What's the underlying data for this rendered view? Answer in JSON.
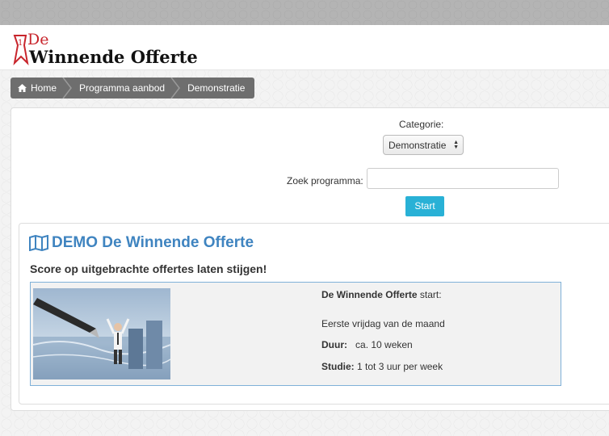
{
  "logo": {
    "small": "De",
    "main": "Winnende Offerte"
  },
  "breadcrumb": {
    "home": "Home",
    "programs": "Programma aanbod",
    "current": "Demonstratie"
  },
  "filter": {
    "category_label": "Categorie:",
    "category_value": "Demonstratie",
    "search_label": "Zoek programma:",
    "search_value": "",
    "start_label": "Start"
  },
  "program": {
    "title": "DEMO De Winnende Offerte",
    "subtitle": "Score op uitgebrachte offertes laten stijgen!",
    "name": "De Winnende Offerte",
    "start_suffix": "start:",
    "start_date": "Eerste vrijdag van de maand",
    "duration_label": "Duur:",
    "duration_value": "ca. 10 weken",
    "study_label": "Studie:",
    "study_value": "1 tot 3 uur per week"
  },
  "colors": {
    "accent": "#3f84c0",
    "button": "#29b1d6",
    "brand_red": "#c8252c"
  }
}
